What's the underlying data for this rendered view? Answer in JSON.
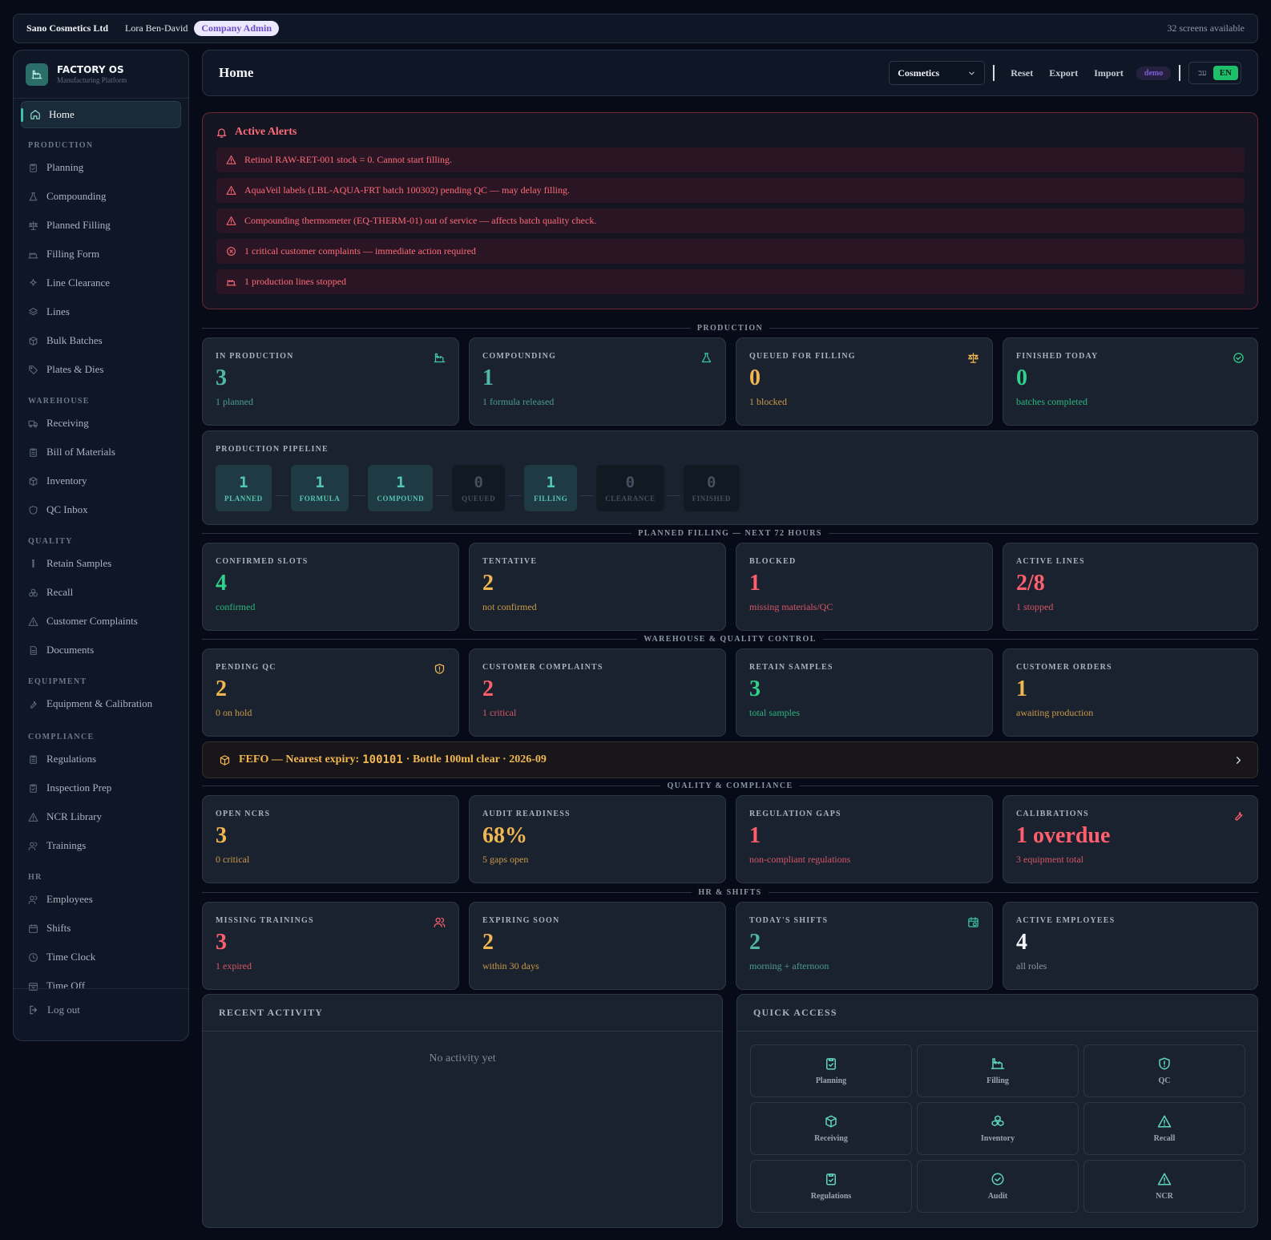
{
  "topbar": {
    "company": "Sano Cosmetics Ltd",
    "user": "Lora Ben-David",
    "role": "Company Admin",
    "screens": "32 screens available"
  },
  "brand": {
    "name": "FACTORY OS",
    "tagline": "Manufacturing Platform"
  },
  "nav": {
    "home": "Home",
    "sections": {
      "production": "PRODUCTION",
      "warehouse": "WAREHOUSE",
      "quality": "QUALITY",
      "equipment": "EQUIPMENT",
      "compliance": "COMPLIANCE",
      "hr": "HR"
    },
    "production": [
      "Planning",
      "Compounding",
      "Planned Filling",
      "Filling Form",
      "Line Clearance",
      "Lines",
      "Bulk Batches",
      "Plates & Dies"
    ],
    "warehouse": [
      "Receiving",
      "Bill of Materials",
      "Inventory",
      "QC Inbox"
    ],
    "quality": [
      "Retain Samples",
      "Recall",
      "Customer Complaints",
      "Documents"
    ],
    "equipment": [
      "Equipment & Calibration"
    ],
    "compliance": [
      "Regulations",
      "Inspection Prep",
      "NCR Library",
      "Trainings"
    ],
    "hr": [
      "Employees",
      "Shifts",
      "Time Clock",
      "Time Off"
    ],
    "logout": "Log out"
  },
  "header": {
    "title": "Home",
    "select_value": "Cosmetics",
    "reset": "Reset",
    "export": "Export",
    "import": "Import",
    "demo": "demo",
    "lang_he": "עב",
    "lang_en": "EN"
  },
  "alerts": {
    "title": "Active Alerts",
    "items": [
      "Retinol RAW-RET-001 stock = 0. Cannot start filling.",
      "AquaVeil labels (LBL-AQUA-FRT batch 100302) pending QC — may delay filling.",
      "Compounding thermometer (EQ-THERM-01) out of service — affects batch quality check.",
      "1 critical customer complaints — immediate action required",
      "1 production lines stopped"
    ]
  },
  "sections": {
    "production": "PRODUCTION",
    "planned_filling": "PLANNED FILLING — NEXT 72 HOURS",
    "warehouse_qc": "WAREHOUSE & QUALITY CONTROL",
    "quality_compliance": "QUALITY & COMPLIANCE",
    "hr_shifts": "HR & SHIFTS"
  },
  "production_cards": [
    {
      "label": "IN PRODUCTION",
      "value": "3",
      "sub": "1 planned"
    },
    {
      "label": "COMPOUNDING",
      "value": "1",
      "sub": "1 formula released"
    },
    {
      "label": "QUEUED FOR FILLING",
      "value": "0",
      "sub": "1 blocked"
    },
    {
      "label": "FINISHED TODAY",
      "value": "0",
      "sub": "batches completed"
    }
  ],
  "pipeline": {
    "title": "PRODUCTION PIPELINE",
    "stages": [
      {
        "count": "1",
        "label": "PLANNED"
      },
      {
        "count": "1",
        "label": "FORMULA"
      },
      {
        "count": "1",
        "label": "COMPOUND"
      },
      {
        "count": "0",
        "label": "QUEUED"
      },
      {
        "count": "1",
        "label": "FILLING"
      },
      {
        "count": "0",
        "label": "CLEARANCE"
      },
      {
        "count": "0",
        "label": "FINISHED"
      }
    ]
  },
  "filling_cards": [
    {
      "label": "CONFIRMED SLOTS",
      "value": "4",
      "sub": "confirmed"
    },
    {
      "label": "TENTATIVE",
      "value": "2",
      "sub": "not confirmed"
    },
    {
      "label": "BLOCKED",
      "value": "1",
      "sub": "missing materials/QC"
    },
    {
      "label": "ACTIVE LINES",
      "value": "2/8",
      "sub": "1 stopped"
    }
  ],
  "warehouse_cards": [
    {
      "label": "PENDING QC",
      "value": "2",
      "sub": "0 on hold"
    },
    {
      "label": "CUSTOMER COMPLAINTS",
      "value": "2",
      "sub": "1 critical"
    },
    {
      "label": "RETAIN SAMPLES",
      "value": "3",
      "sub": "total samples"
    },
    {
      "label": "CUSTOMER ORDERS",
      "value": "1",
      "sub": "awaiting production"
    }
  ],
  "fefo": {
    "prefix": "FEFO — Nearest expiry:",
    "batch": "100101",
    "rest": "· Bottle 100ml clear · 2026-09"
  },
  "quality_cards": [
    {
      "label": "OPEN NCRS",
      "value": "3",
      "sub": "0 critical"
    },
    {
      "label": "AUDIT READINESS",
      "value": "68%",
      "sub": "5 gaps open"
    },
    {
      "label": "REGULATION GAPS",
      "value": "1",
      "sub": "non-compliant regulations"
    },
    {
      "label": "CALIBRATIONS",
      "value": "1 overdue",
      "sub": "3 equipment total"
    }
  ],
  "hr_cards": [
    {
      "label": "MISSING TRAININGS",
      "value": "3",
      "sub": "1 expired"
    },
    {
      "label": "EXPIRING SOON",
      "value": "2",
      "sub": "within 30 days"
    },
    {
      "label": "TODAY'S SHIFTS",
      "value": "2",
      "sub": "morning + afternoon"
    },
    {
      "label": "ACTIVE EMPLOYEES",
      "value": "4",
      "sub": "all roles"
    }
  ],
  "recent_activity": {
    "title": "RECENT ACTIVITY",
    "empty": "No activity yet"
  },
  "quick_access": {
    "title": "QUICK ACCESS",
    "items": [
      "Planning",
      "Filling",
      "QC",
      "Receiving",
      "Inventory",
      "Recall",
      "Regulations",
      "Audit",
      "NCR"
    ]
  },
  "colors": {
    "accent": "#3cc6a8",
    "warning": "#f1b650",
    "danger": "#ff5f6d",
    "success": "#2fd28a",
    "background": "#060b17"
  }
}
